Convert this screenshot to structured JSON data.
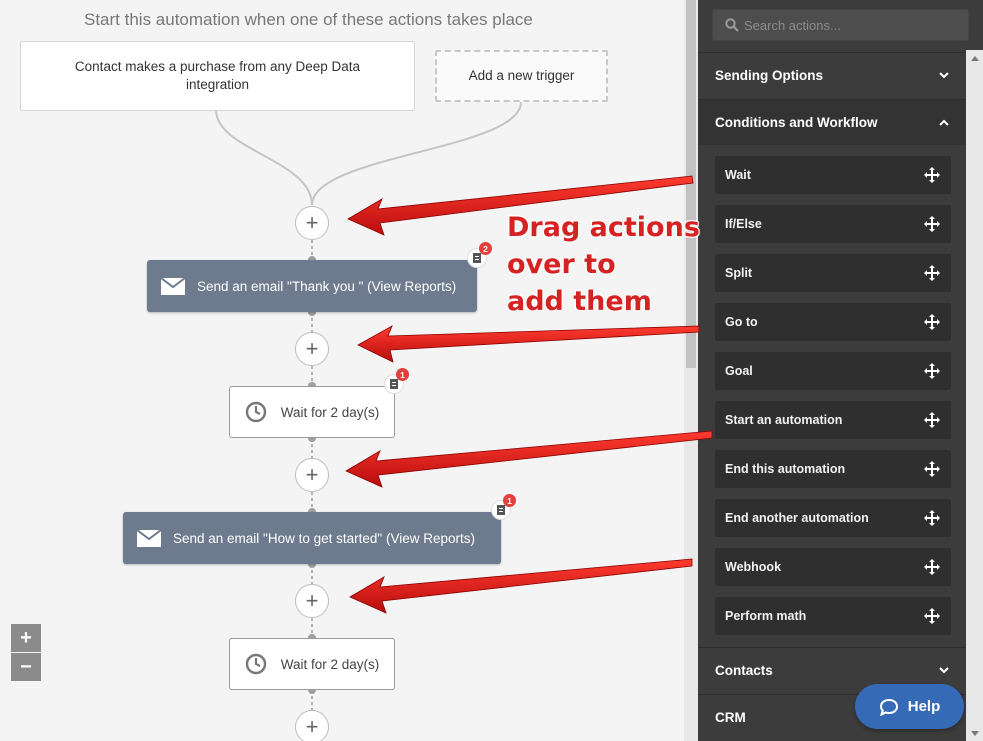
{
  "canvas": {
    "start_text": "Start this automation when one of these actions takes place",
    "triggers": [
      {
        "label": "Contact makes a purchase from any Deep Data integration"
      },
      {
        "label": "Add a new trigger"
      }
    ],
    "nodes": [
      {
        "type": "email",
        "label": "Send an email \"Thank you \" (View Reports)",
        "badge_count": "2",
        "icon": "envelope-icon"
      },
      {
        "type": "wait",
        "label": "Wait for 2 day(s)",
        "badge_count": "1",
        "icon": "clock-icon"
      },
      {
        "type": "email",
        "label": "Send an email \"How to get started\" (View Reports)",
        "badge_count": "1",
        "icon": "envelope-icon"
      },
      {
        "type": "wait",
        "label": "Wait for 2 day(s)",
        "icon": "clock-icon"
      }
    ],
    "plus_symbol": "+",
    "zoom": {
      "in": "+",
      "out": "−"
    },
    "annotation": [
      "Drag actions",
      "over to",
      "add them"
    ],
    "annotation_color": "#d42322"
  },
  "panel": {
    "search_placeholder": "Search actions...",
    "sections": [
      {
        "label": "Sending Options",
        "expanded": false
      },
      {
        "label": "Conditions and Workflow",
        "expanded": true
      },
      {
        "label": "Contacts",
        "expanded": false
      },
      {
        "label": "CRM",
        "expanded": false
      }
    ],
    "actions": [
      "Wait",
      "If/Else",
      "Split",
      "Go to",
      "Goal",
      "Start an automation",
      "End this automation",
      "End another automation",
      "Webhook",
      "Perform math"
    ]
  },
  "help": {
    "label": "Help"
  },
  "colors": {
    "panel_bg": "#3c3c3c",
    "email_node": "#6e7a8e",
    "help_button": "#356ab7",
    "badge": "#e0413c"
  }
}
